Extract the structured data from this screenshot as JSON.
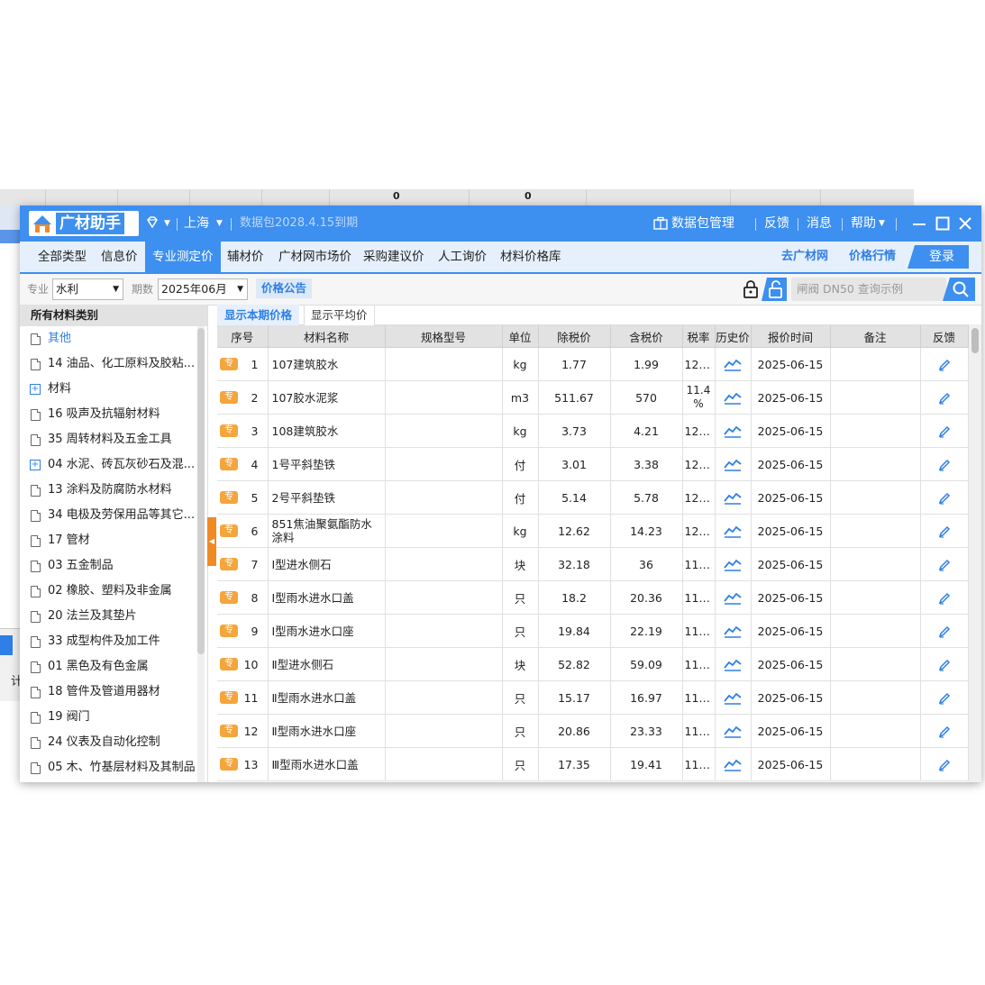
{
  "background": {
    "col_values": [
      "0",
      "0"
    ],
    "bottom_char": "计"
  },
  "app": {
    "logo_text": "广材助手",
    "region": "上海",
    "package_info": "数据包2028.4.15到期",
    "package_mgmt": "数据包管理",
    "feedback": "反馈",
    "messages": "消息",
    "help": "帮助"
  },
  "menu": {
    "items": [
      "全部类型",
      "信息价",
      "专业测定价",
      "辅材价",
      "广材网市场价",
      "采购建议价",
      "人工询价",
      "材料价格库"
    ],
    "active": "专业测定价",
    "link_site": "去广材网",
    "link_trend": "价格行情",
    "login": "登录"
  },
  "filters": {
    "specialty_label": "专业",
    "specialty_value": "水利",
    "period_label": "期数",
    "period_value": "2025年06月",
    "notice": "价格公告",
    "search_placeholder": "闸阀 DN50 查询示例"
  },
  "sidebar": {
    "title": "所有材料类别",
    "items": [
      {
        "label": "其他",
        "icon": "doc",
        "selected": true
      },
      {
        "label": "14 油品、化工原料及胶粘...",
        "icon": "doc"
      },
      {
        "label": "材料",
        "icon": "plus"
      },
      {
        "label": "16 吸声及抗辐射材料",
        "icon": "doc"
      },
      {
        "label": "35 周转材料及五金工具",
        "icon": "doc"
      },
      {
        "label": "04 水泥、砖瓦灰砂石及混...",
        "icon": "plus"
      },
      {
        "label": "13 涂料及防腐防水材料",
        "icon": "doc"
      },
      {
        "label": "34 电极及劳保用品等其它...",
        "icon": "doc"
      },
      {
        "label": "17 管材",
        "icon": "doc"
      },
      {
        "label": "03 五金制品",
        "icon": "doc"
      },
      {
        "label": "02 橡胶、塑料及非金属",
        "icon": "doc"
      },
      {
        "label": "20 法兰及其垫片",
        "icon": "doc"
      },
      {
        "label": "33 成型构件及加工件",
        "icon": "doc"
      },
      {
        "label": "01 黑色及有色金属",
        "icon": "doc"
      },
      {
        "label": "18 管件及管道用器材",
        "icon": "doc"
      },
      {
        "label": "19 阀门",
        "icon": "doc"
      },
      {
        "label": "24 仪表及自动化控制",
        "icon": "doc"
      },
      {
        "label": "05 木、竹基层材料及其制品",
        "icon": "doc"
      }
    ]
  },
  "tabs": [
    "显示本期价格",
    "显示平均价"
  ],
  "table": {
    "badge": "专",
    "columns": [
      "序号",
      "材料名称",
      "规格型号",
      "单位",
      "除税价",
      "含税价",
      "税率",
      "历史价",
      "报价时间",
      "备注",
      "反馈"
    ],
    "rows": [
      {
        "seq": "1",
        "name": "107建筑胶水",
        "spec": "",
        "unit": "kg",
        "ex_tax": "1.77",
        "inc_tax": "1.99",
        "rate": "12....",
        "date": "2025-06-15",
        "note": ""
      },
      {
        "seq": "2",
        "name": "107胶水泥浆",
        "spec": "",
        "unit": "m3",
        "ex_tax": "511.67",
        "inc_tax": "570",
        "rate": "11.4 %",
        "date": "2025-06-15",
        "note": ""
      },
      {
        "seq": "3",
        "name": "108建筑胶水",
        "spec": "",
        "unit": "kg",
        "ex_tax": "3.73",
        "inc_tax": "4.21",
        "rate": "12....",
        "date": "2025-06-15",
        "note": ""
      },
      {
        "seq": "4",
        "name": "1号平斜垫铁",
        "spec": "",
        "unit": "付",
        "ex_tax": "3.01",
        "inc_tax": "3.38",
        "rate": "12....",
        "date": "2025-06-15",
        "note": ""
      },
      {
        "seq": "5",
        "name": "2号平斜垫铁",
        "spec": "",
        "unit": "付",
        "ex_tax": "5.14",
        "inc_tax": "5.78",
        "rate": "12....",
        "date": "2025-06-15",
        "note": ""
      },
      {
        "seq": "6",
        "name": "851焦油聚氨酯防水涂料",
        "spec": "",
        "unit": "kg",
        "ex_tax": "12.62",
        "inc_tax": "14.23",
        "rate": "12....",
        "date": "2025-06-15",
        "note": ""
      },
      {
        "seq": "7",
        "name": "Ⅰ型进水侧石",
        "spec": "",
        "unit": "块",
        "ex_tax": "32.18",
        "inc_tax": "36",
        "rate": "11....",
        "date": "2025-06-15",
        "note": ""
      },
      {
        "seq": "8",
        "name": "Ⅰ型雨水进水口盖",
        "spec": "",
        "unit": "只",
        "ex_tax": "18.2",
        "inc_tax": "20.36",
        "rate": "11....",
        "date": "2025-06-15",
        "note": ""
      },
      {
        "seq": "9",
        "name": "Ⅰ型雨水进水口座",
        "spec": "",
        "unit": "只",
        "ex_tax": "19.84",
        "inc_tax": "22.19",
        "rate": "11....",
        "date": "2025-06-15",
        "note": ""
      },
      {
        "seq": "10",
        "name": "Ⅱ型进水侧石",
        "spec": "",
        "unit": "块",
        "ex_tax": "52.82",
        "inc_tax": "59.09",
        "rate": "11....",
        "date": "2025-06-15",
        "note": ""
      },
      {
        "seq": "11",
        "name": "Ⅱ型雨水进水口盖",
        "spec": "",
        "unit": "只",
        "ex_tax": "15.17",
        "inc_tax": "16.97",
        "rate": "11....",
        "date": "2025-06-15",
        "note": ""
      },
      {
        "seq": "12",
        "name": "Ⅱ型雨水进水口座",
        "spec": "",
        "unit": "只",
        "ex_tax": "20.86",
        "inc_tax": "23.33",
        "rate": "11....",
        "date": "2025-06-15",
        "note": ""
      },
      {
        "seq": "13",
        "name": "Ⅲ型雨水进水口盖",
        "spec": "",
        "unit": "只",
        "ex_tax": "17.35",
        "inc_tax": "19.41",
        "rate": "11....",
        "date": "2025-06-15",
        "note": ""
      }
    ]
  },
  "icons": {
    "logo": "logo-icon",
    "diamond": "diamond-icon",
    "briefcase": "briefcase-icon",
    "minimize": "minimize-icon",
    "maximize": "maximize-icon",
    "close": "close-icon",
    "lock": "lock-icon",
    "unlock": "unlock-icon",
    "search": "search-icon",
    "trend": "trend-chart-icon",
    "edit": "pencil-icon"
  },
  "colors": {
    "primary": "#3d8ff0",
    "badge": "#f4a53c",
    "collapse": "#f08a24"
  }
}
